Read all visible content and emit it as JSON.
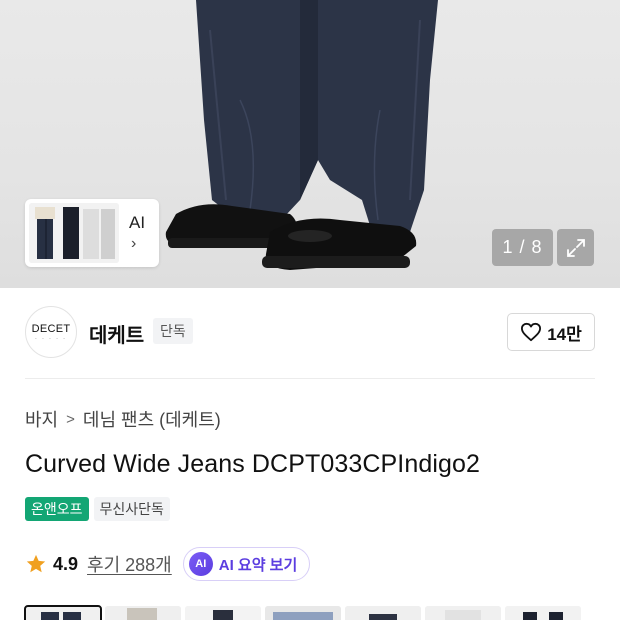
{
  "gallery": {
    "counter": "1 / 8",
    "ai_label": "AI",
    "ai_chevron": "›",
    "expand_icon": "expand-icon"
  },
  "brand": {
    "logo_text": "DECET",
    "logo_sub": "- - - - -",
    "name": "데케트",
    "badge": "단독",
    "like_count": "14만",
    "like_icon": "heart-icon"
  },
  "breadcrumb": {
    "items": [
      "바지",
      "데님 팬츠 (데케트)"
    ],
    "separator": ">"
  },
  "product": {
    "title": "Curved Wide Jeans DCPT033CPIndigo2",
    "tags": [
      {
        "label": "온앤오프",
        "color": "#13a674"
      },
      {
        "label": "무신사단독"
      }
    ]
  },
  "rating": {
    "value": "4.9",
    "reviews": "후기 288개",
    "star_color": "#f0a020",
    "ai_badge": "AI",
    "ai_summary": "AI 요약 보기"
  },
  "thumbnails": {
    "count": 8,
    "active_index": 0
  }
}
